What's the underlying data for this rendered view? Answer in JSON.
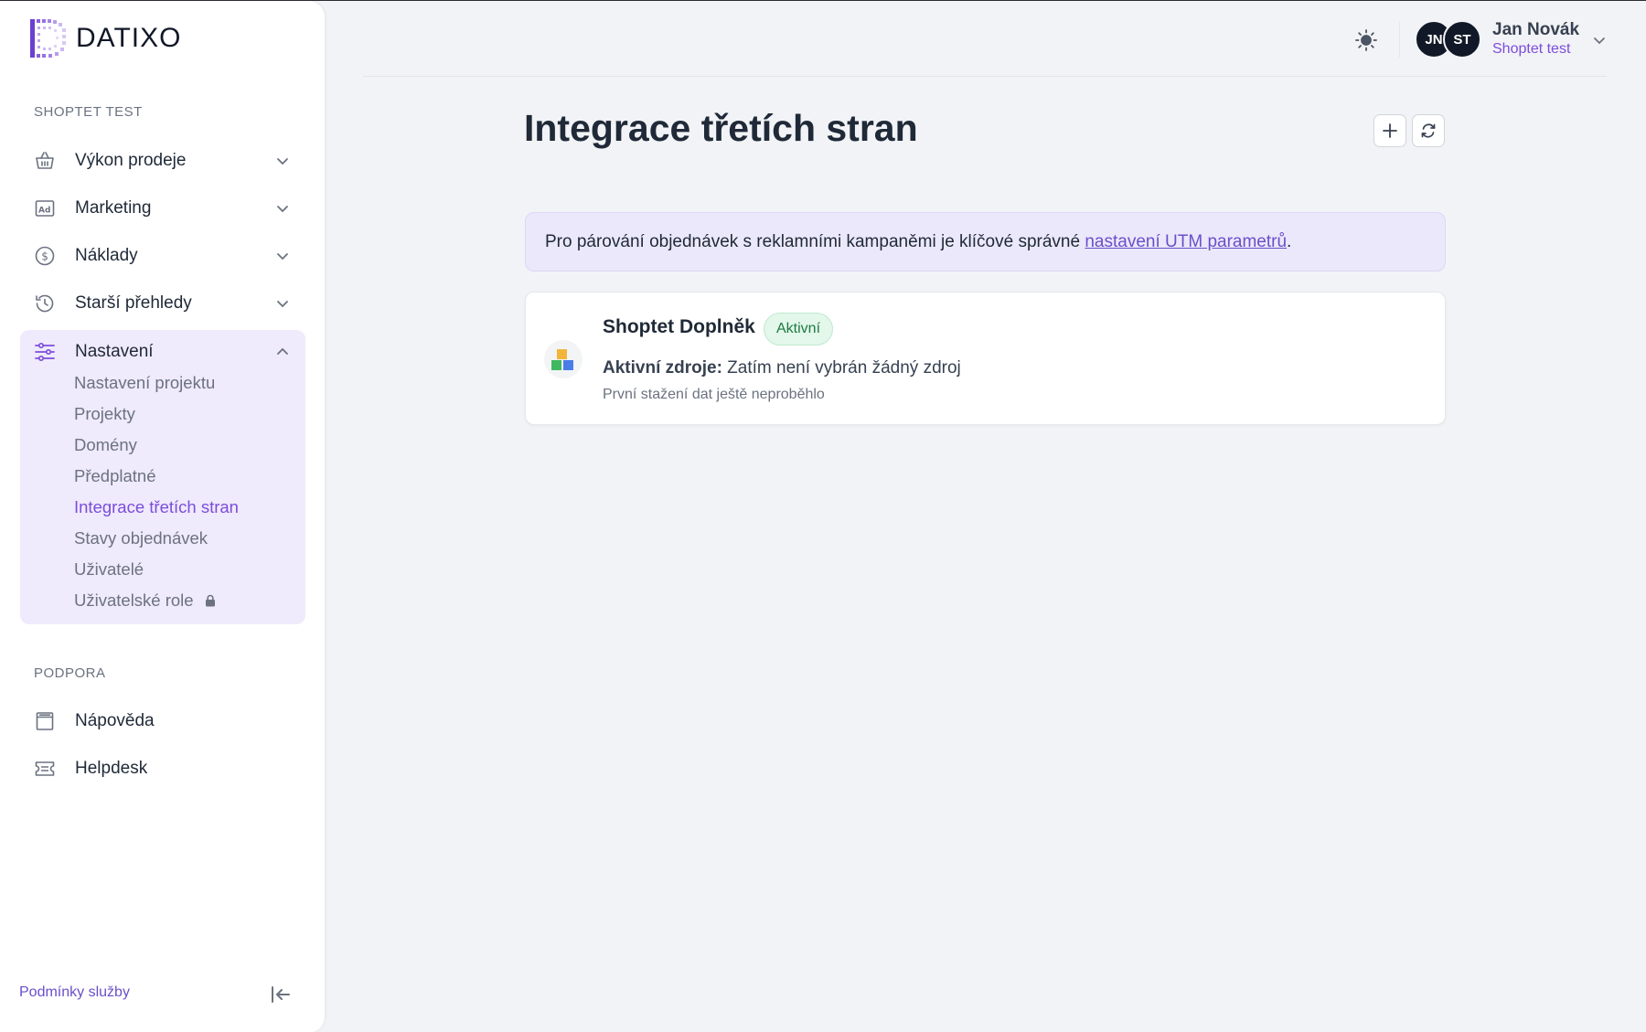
{
  "brand": {
    "name": "DATIXO"
  },
  "sidebar": {
    "project_section": "SHOPTET TEST",
    "items": [
      {
        "label": "Výkon prodeje",
        "icon": "basket-icon"
      },
      {
        "label": "Marketing",
        "icon": "ad-icon"
      },
      {
        "label": "Náklady",
        "icon": "coin-icon"
      },
      {
        "label": "Starší přehledy",
        "icon": "history-icon"
      },
      {
        "label": "Nastavení",
        "icon": "sliders-icon"
      }
    ],
    "settings_sub": [
      {
        "label": "Nastavení projektu"
      },
      {
        "label": "Projekty"
      },
      {
        "label": "Domény"
      },
      {
        "label": "Předplatné"
      },
      {
        "label": "Integrace třetích stran"
      },
      {
        "label": "Stavy objednávek"
      },
      {
        "label": "Uživatelé"
      },
      {
        "label": "Uživatelské role"
      }
    ],
    "support_section": "PODPORA",
    "support_items": [
      {
        "label": "Nápověda",
        "icon": "book-icon"
      },
      {
        "label": "Helpdesk",
        "icon": "ticket-icon"
      }
    ],
    "terms_link": "Podmínky služby"
  },
  "header": {
    "avatars": [
      "JN",
      "ST"
    ],
    "user_name": "Jan Novák",
    "user_project": "Shoptet test"
  },
  "main": {
    "title": "Integrace třetích stran",
    "banner_text": "Pro párování objednávek s reklamními kampaněmi je klíčové správné ",
    "banner_link": "nastavení UTM parametrů",
    "banner_end": ".",
    "integration": {
      "name": "Shoptet Doplněk",
      "status": "Aktivní",
      "sources_label": "Aktivní zdroje:",
      "sources_value": " Zatím není vybrán žádný zdroj",
      "note": "První stažení dat ještě neproběhlo"
    }
  },
  "colors": {
    "accent": "#7c4ddb",
    "settings_bg": "#efeafc",
    "badge_bg": "#e3f7ea"
  }
}
